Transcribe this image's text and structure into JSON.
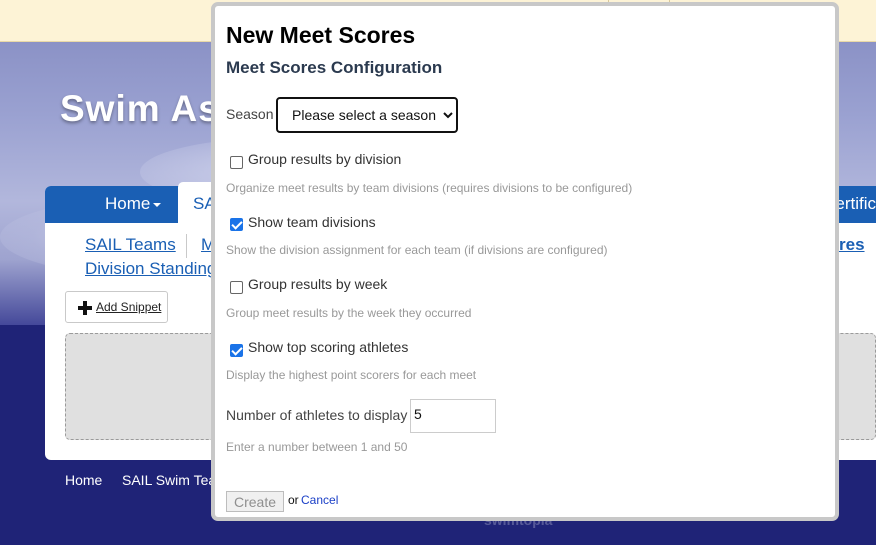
{
  "site": {
    "title": "Swim As",
    "nav": {
      "home": "Home",
      "active_tab": "SA",
      "right_item": "ertific"
    },
    "sub_nav": [
      "SAIL Teams",
      "M",
      "Division Standings",
      "res"
    ],
    "add_snippet": "Add Snippet",
    "footer": [
      "Home",
      "SAIL Swim Tea"
    ],
    "footer_logo": "swimtopia"
  },
  "modal": {
    "title": "New Meet Scores",
    "subtitle": "Meet Scores Configuration",
    "season": {
      "label": "Season",
      "selected": "Please select a season"
    },
    "options": [
      {
        "label": "Group results by division",
        "checked": false,
        "hint": "Organize meet results by team divisions (requires divisions to be configured)"
      },
      {
        "label": "Show team divisions",
        "checked": true,
        "hint": "Show the division assignment for each team (if divisions are configured)"
      },
      {
        "label": "Group results by week",
        "checked": false,
        "hint": "Group meet results by the week they occurred"
      },
      {
        "label": "Show top scoring athletes",
        "checked": true,
        "hint": "Display the highest point scorers for each meet"
      }
    ],
    "athletes": {
      "label": "Number of athletes to display",
      "value": "5",
      "hint": "Enter a number between 1 and 50"
    },
    "create_label": "Create",
    "or_text": "or",
    "cancel_label": "Cancel"
  },
  "colors": {
    "nav": "#1a5fb4",
    "checkbox": "#1a73e8",
    "band": "#1f2377"
  }
}
